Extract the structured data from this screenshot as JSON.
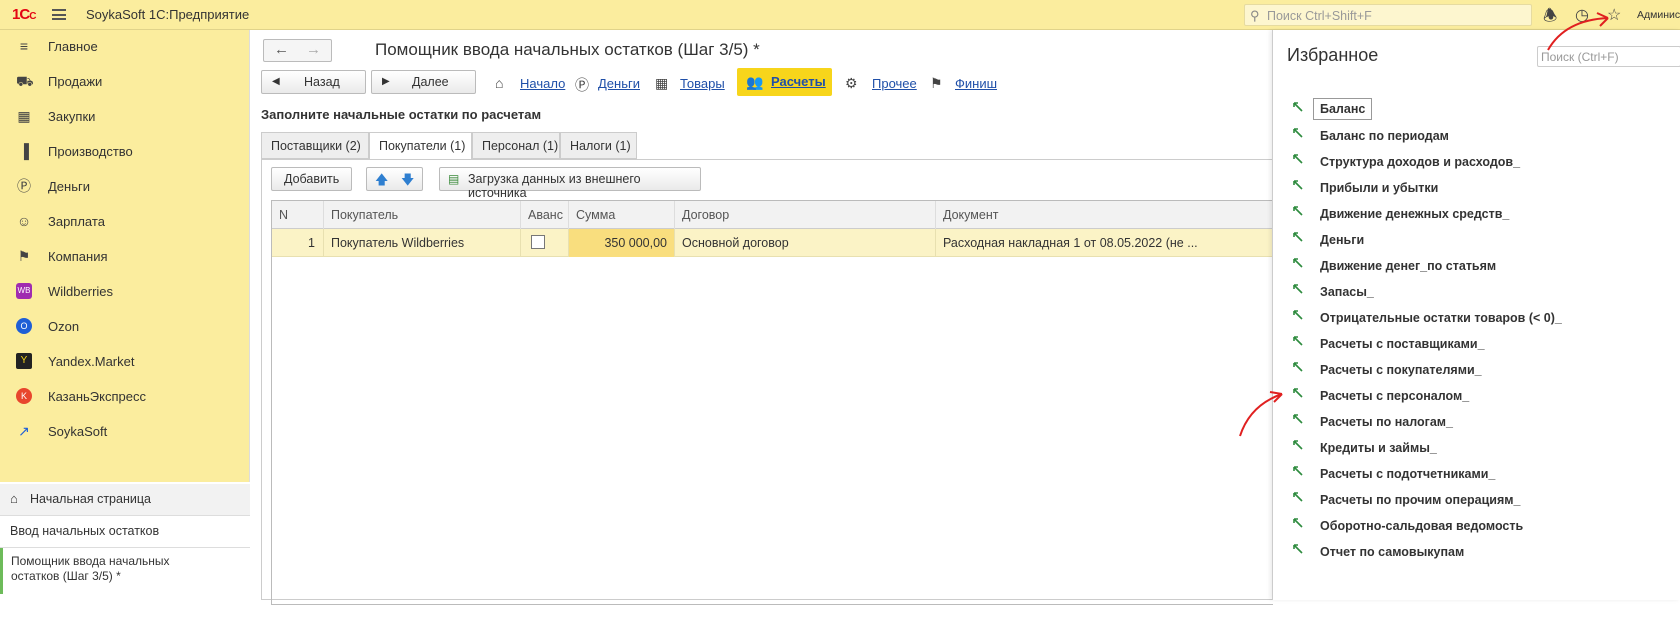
{
  "app": {
    "logo": "1С",
    "title": "SoykaSoft 1С:Предприятие",
    "search_placeholder": "Поиск Ctrl+Shift+F",
    "user": "Админис"
  },
  "sidebar": {
    "items": [
      {
        "label": "Главное",
        "icon": "menu-lines-icon"
      },
      {
        "label": "Продажи",
        "icon": "cart-icon"
      },
      {
        "label": "Закупки",
        "icon": "basket-icon"
      },
      {
        "label": "Производство",
        "icon": "factory-icon"
      },
      {
        "label": "Деньги",
        "icon": "ruble-icon"
      },
      {
        "label": "Зарплата",
        "icon": "people-icon"
      },
      {
        "label": "Компания",
        "icon": "flag-icon"
      },
      {
        "label": "Wildberries",
        "icon": "wb-icon"
      },
      {
        "label": "Ozon",
        "icon": "ozon-icon"
      },
      {
        "label": "Yandex.Market",
        "icon": "ym-icon"
      },
      {
        "label": "КазаньЭкспресс",
        "icon": "ke-icon"
      },
      {
        "label": "SoykaSoft",
        "icon": "soyka-icon"
      }
    ],
    "nav": {
      "home": "Начальная страница",
      "entry": "Ввод начальных остатков",
      "active": "Помощник ввода начальных остатков (Шаг 3/5) *"
    }
  },
  "main": {
    "title": "Помощник ввода начальных остатков (Шаг 3/5) *",
    "back": "Назад",
    "next": "Далее",
    "steps": [
      "Начало",
      "Деньги",
      "Товары",
      "Расчеты",
      "Прочее",
      "Финиш"
    ],
    "instruction": "Заполните начальные остатки по расчетам",
    "tabs": [
      "Поставщики (2)",
      "Покупатели (1)",
      "Персонал (1)",
      "Налоги (1)"
    ],
    "selected_tab": "Покупатели (1)",
    "add_button": "Добавить",
    "load_button": "Загрузка данных из внешнего источника",
    "table": {
      "columns": [
        "N",
        "Покупатель",
        "Аванс",
        "Сумма",
        "Договор",
        "Документ"
      ],
      "rows": [
        {
          "n": "1",
          "buyer": "Покупатель Wildberries",
          "advance": false,
          "sum": "350 000,00",
          "contract": "Основной договор",
          "document": "Расходная накладная 1  от 08.05.2022 (не ..."
        }
      ]
    }
  },
  "favorites": {
    "title": "Избранное",
    "search_placeholder": "Поиск (Ctrl+F)",
    "items": [
      "Баланс",
      "Баланс по периодам",
      "Структура доходов и расходов_",
      "Прибыли и убытки",
      "Движение денежных средств_",
      "Деньги",
      "Движение денег_по статьям",
      "Запасы_",
      "Отрицательные остатки товаров (< 0)_",
      "Расчеты с поставщиками_",
      "Расчеты с покупателями_",
      "Расчеты с персоналом_",
      "Расчеты по налогам_",
      "Кредиты и займы_",
      "Расчеты с подотчетниками_",
      "Расчеты по прочим операциям_",
      "Оборотно-сальдовая ведомость",
      "Отчет по самовыкупам"
    ],
    "selected": "Баланс"
  },
  "colors": {
    "accent": "#f7d51b",
    "sidebar": "#fbed9e",
    "link": "#1f4fa8",
    "annotation": "#e02020"
  }
}
